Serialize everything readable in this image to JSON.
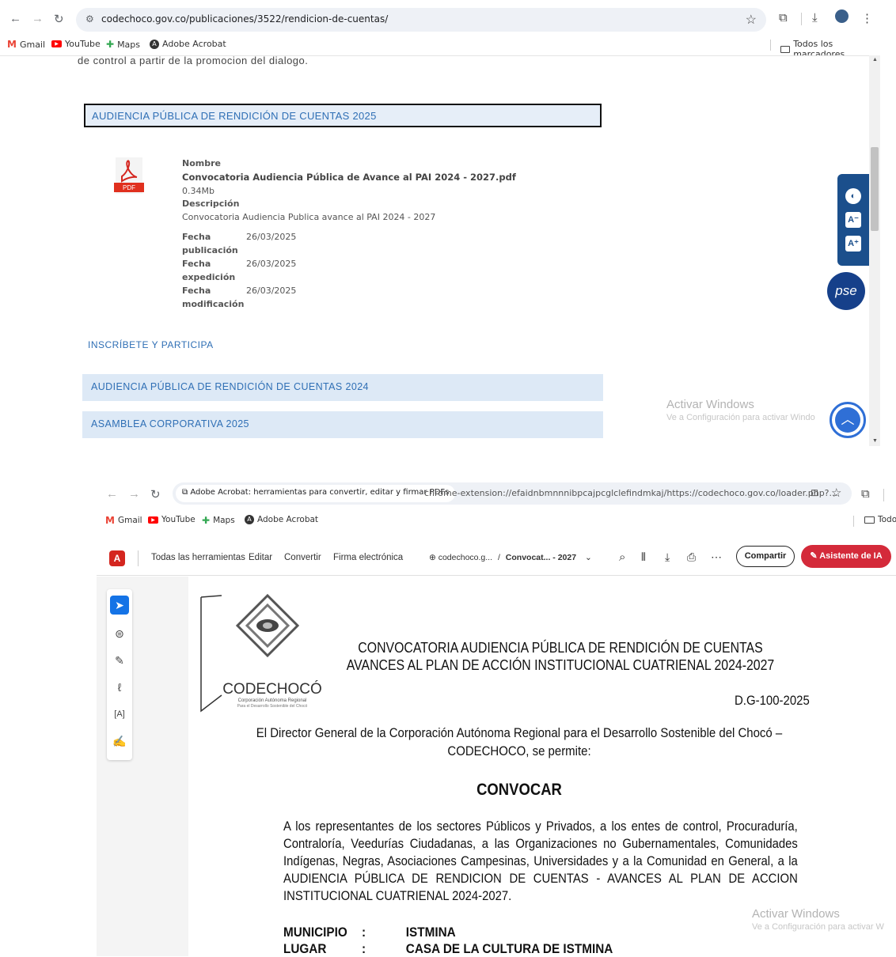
{
  "browser1": {
    "url": "codechoco.gov.co/publicaciones/3522/rendicion-de-cuentas/",
    "bookmarks": [
      "Gmail",
      "YouTube",
      "Maps",
      "Adobe Acrobat"
    ],
    "all_bookmarks": "Todos los marcadores"
  },
  "page1": {
    "clipped_text": "de control a partir de la promocion del dialogo.",
    "section_open": "AUDIENCIA PÚBLICA DE RENDICIÓN DE CUENTAS 2025",
    "file": {
      "icon_label": "PDF",
      "name_label": "Nombre",
      "name": "Convocatoria Audiencia Pública de Avance al PAI 2024 - 2027.pdf",
      "size": "0.34Mb",
      "desc_label": "Descripción",
      "description": "Convocatoria Audiencia Publica avance al PAI 2024 - 2027",
      "fecha_pub_label_1": "Fecha",
      "fecha_pub_label_2": "publicación",
      "fecha_pub": "26/03/2025",
      "fecha_exp_label_1": "Fecha",
      "fecha_exp_label_2": "expedición",
      "fecha_exp": "26/03/2025",
      "fecha_mod_label_1": "Fecha",
      "fecha_mod_label_2": "modificación",
      "fecha_mod": "26/03/2025"
    },
    "link_inscribete": "INSCRÍBETE Y PARTICIPA",
    "section_2024": "AUDIENCIA PÚBLICA DE RENDICIÓN DE CUENTAS 2024",
    "section_asamblea": "ASAMBLEA CORPORATIVA 2025",
    "pse_label": "pse"
  },
  "windows_watermark": {
    "title": "Activar Windows",
    "subtitle_1": "Ve a Configuración para activar Windo",
    "subtitle_2": "Ve a Configuración para activar W"
  },
  "browser2": {
    "chip": "Adobe Acrobat: herramientas para convertir, editar y firmar PDFs",
    "url": "chrome-extension://efaidnbmnnnibpcajpcglclefindmkaj/https://codechoco.gov.co/loader.php?...",
    "bookmarks": [
      "Gmail",
      "YouTube",
      "Maps",
      "Adobe Acrobat"
    ],
    "all_bookmarks": "Todo"
  },
  "acrobat": {
    "menu": [
      "Todas las herramientas",
      "Editar",
      "Convertir",
      "Firma electrónica"
    ],
    "doc_site": "codechoco.g...",
    "doc_sep": "/",
    "doc_title": "Convocat... - 2027",
    "share": "Compartir",
    "ai_assistant": "Asistente de IA"
  },
  "document": {
    "logo_name": "CODECHOCÓ",
    "logo_sub": "Corporación Autónoma Regional",
    "logo_sub2": "Para el Desarrollo Sostenible del Chocó",
    "heading_1": "CONVOCATORIA AUDIENCIA PÚBLICA DE RENDICIÓN DE CUENTAS",
    "heading_2": "AVANCES AL PLAN DE ACCIÓN INSTITUCIONAL CUATRIENAL 2024-2027",
    "ref": "D.G-100-2025",
    "intro_1": "El Director General de la Corporación Autónoma Regional para el Desarrollo Sostenible del Chocó –",
    "intro_2": "CODECHOCO, se permite:",
    "convocar": "CONVOCAR",
    "body": "A los representantes de los sectores Públicos y Privados, a los entes de control, Procuraduría, Contraloría, Veedurías Ciudadanas, a las Organizaciones no Gubernamentales, Comunidades Indígenas, Negras, Asociaciones Campesinas, Universidades y a la Comunidad en General, a la AUDIENCIA PÚBLICA DE RENDICION DE CUENTAS - AVANCES AL PLAN DE ACCION INSTITUCIONAL CUATRIENAL 2024-2027.",
    "rows": [
      {
        "label": "MUNICIPIO",
        "sep": ":",
        "value": "ISTMINA"
      },
      {
        "label": "LUGAR",
        "sep": ":",
        "value": "CASA DE LA CULTURA DE ISTMINA"
      }
    ]
  }
}
